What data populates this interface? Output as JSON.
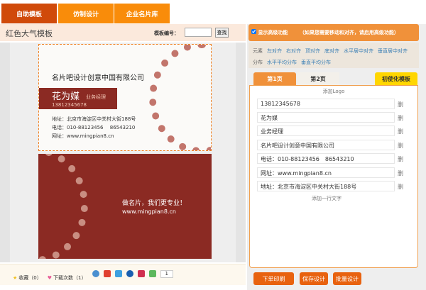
{
  "tabs": [
    "自助模板",
    "仿制设计",
    "企业名片库"
  ],
  "title": "红色大气模板",
  "search": {
    "label": "模板编号：",
    "value": "",
    "button": "查找"
  },
  "card_front": {
    "company": "名片吧设计创意中国有限公司",
    "name": "花为媒",
    "position": "业务经理",
    "mobile": "13812345678",
    "address": "地址：北京市海淀区中关村大街188号",
    "phone": "电话：010-88123456　 86543210",
    "web": "网址：www.mingpian8.cn"
  },
  "card_back": {
    "slogan": "做名片，我们更专业！",
    "web": "www.mingpian8.cn"
  },
  "toolbar": {
    "favorite": "收藏（0）",
    "downloads": "下载次数（1）",
    "page": "1"
  },
  "advanced": {
    "checkbox_label": "显示高级功能",
    "checked": true,
    "hint": "（如果您需要移动和对齐，请启用高级功能）"
  },
  "align": {
    "label": "元素",
    "items": [
      "左对齐",
      "右对齐",
      "顶对齐",
      "底对齐",
      "水平居中对齐",
      "垂直居中对齐"
    ]
  },
  "distribute": {
    "label": "分布",
    "items": [
      "水平平均分布",
      "垂直平均分布"
    ]
  },
  "page_tabs": [
    "第1页",
    "第2页"
  ],
  "init_button": "初使化模板",
  "add_logo": "添加Logo",
  "fields": [
    "13812345678",
    "花为媒",
    "业务经理",
    "名片吧设计创意中国有限公司",
    "电话：010-88123456　86543210",
    "网址：www.mingpian8.cn",
    "地址：北京市海淀区中关村大街188号"
  ],
  "delete_label": "删",
  "add_line": "添加一行文字",
  "actions": [
    "下单印刷",
    "保存设计",
    "批量设计"
  ],
  "colors": {
    "accent": "#e8620f",
    "card": "#8b2a23"
  }
}
